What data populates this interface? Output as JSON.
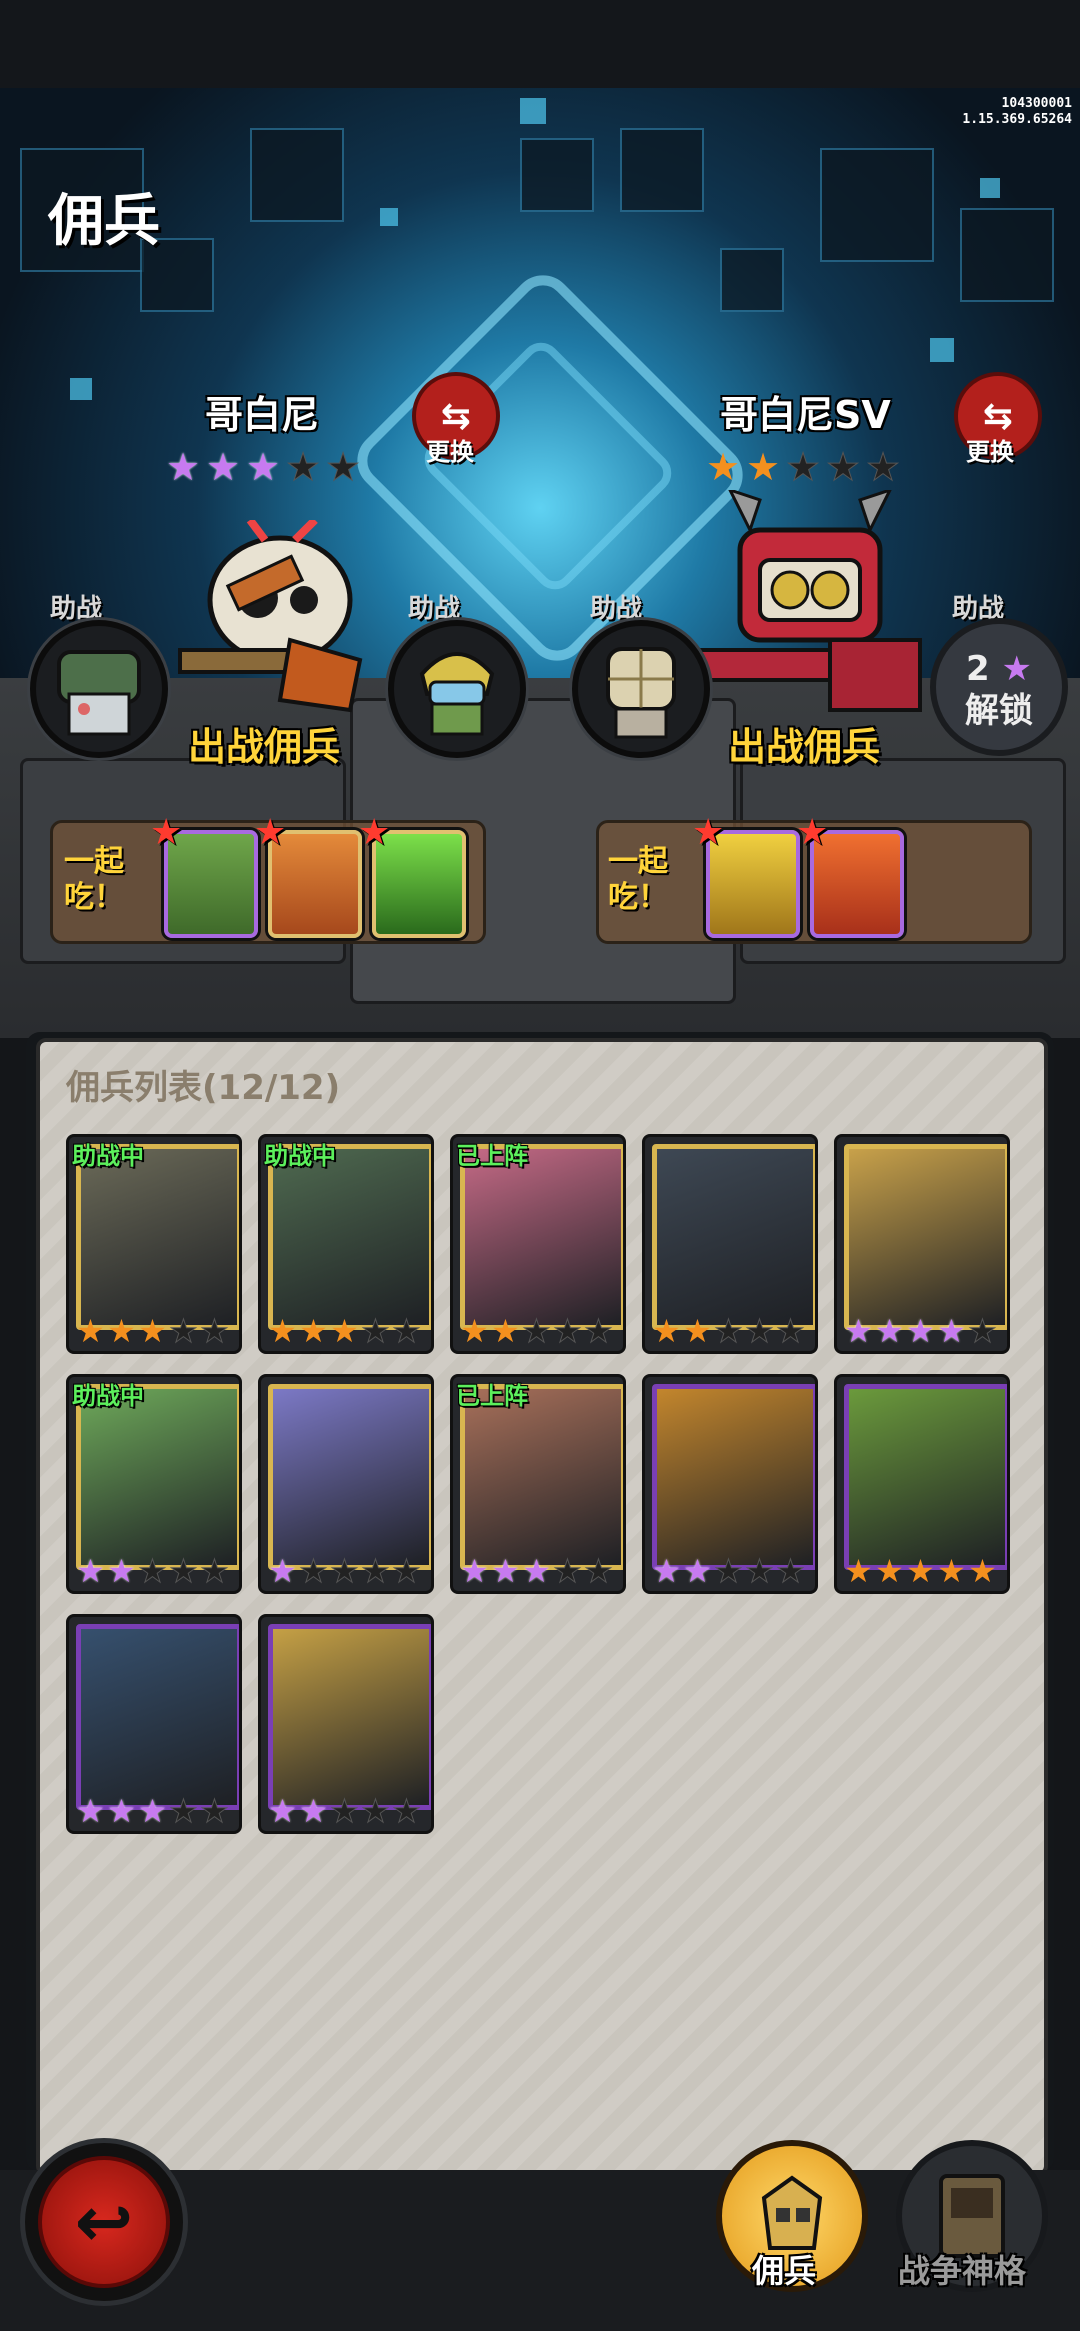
{
  "version": {
    "line1": "104300001",
    "line2": "1.15.369.65264"
  },
  "page_title": "佣兵",
  "slots": [
    {
      "name": "哥白尼",
      "swap_label": "更换",
      "stars": [
        "pur",
        "pur",
        "pur",
        "off",
        "off"
      ],
      "deploy_label": "出战佣兵",
      "eat_label_1": "一起",
      "eat_label_2": "吃！",
      "eat_cards": 3
    },
    {
      "name": "哥白尼SV",
      "swap_label": "更换",
      "stars": [
        "org",
        "org",
        "off",
        "off",
        "off"
      ],
      "deploy_label": "出战佣兵",
      "eat_label_1": "一起",
      "eat_label_2": "吃！",
      "eat_cards": 2
    }
  ],
  "helpers": {
    "label": "助战",
    "unlock_count": "2",
    "unlock_label": "解锁"
  },
  "list": {
    "title": "佣兵列表(12/12)",
    "cards": [
      {
        "badge": "助战中",
        "stars": [
          "org",
          "org",
          "org",
          "off",
          "off"
        ],
        "frame": "gold",
        "color": "#6b6a58"
      },
      {
        "badge": "助战中",
        "stars": [
          "org",
          "org",
          "org",
          "off",
          "off"
        ],
        "frame": "gold",
        "color": "#4f6a50"
      },
      {
        "badge": "已上阵",
        "stars": [
          "org",
          "org",
          "off",
          "off",
          "off"
        ],
        "frame": "gold",
        "color": "#c56a86"
      },
      {
        "badge": "",
        "stars": [
          "org",
          "org",
          "off",
          "off",
          "off"
        ],
        "frame": "gold",
        "color": "#3e4854"
      },
      {
        "badge": "",
        "stars": [
          "pur",
          "pur",
          "pur",
          "pur",
          "off"
        ],
        "frame": "gold",
        "color": "#c8a14a"
      },
      {
        "badge": "助战中",
        "stars": [
          "pur",
          "pur",
          "off",
          "off",
          "off"
        ],
        "frame": "gold",
        "color": "#6ea95a"
      },
      {
        "badge": "",
        "stars": [
          "pur",
          "off",
          "off",
          "off",
          "off"
        ],
        "frame": "gold",
        "color": "#7c79c6"
      },
      {
        "badge": "已上阵",
        "stars": [
          "pur",
          "pur",
          "pur",
          "off",
          "off"
        ],
        "frame": "gold",
        "color": "#a8705a"
      },
      {
        "badge": "",
        "stars": [
          "pur",
          "pur",
          "off",
          "off",
          "off"
        ],
        "frame": "pur",
        "color": "#c3862d"
      },
      {
        "badge": "",
        "stars": [
          "org",
          "org",
          "org",
          "org",
          "org"
        ],
        "frame": "pur",
        "color": "#6b9a3c"
      },
      {
        "badge": "",
        "stars": [
          "pur",
          "pur",
          "pur",
          "off",
          "off"
        ],
        "frame": "pur",
        "color": "#36506e"
      },
      {
        "badge": "",
        "stars": [
          "pur",
          "pur",
          "off",
          "off",
          "off"
        ],
        "frame": "pur",
        "color": "#c5a045"
      }
    ]
  },
  "nav": {
    "tab1": "佣兵",
    "tab2": "战争神格"
  }
}
